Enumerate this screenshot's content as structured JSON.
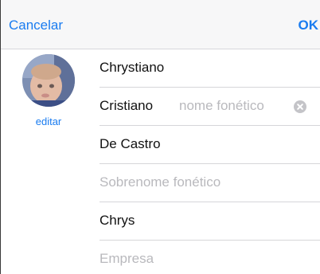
{
  "nav": {
    "cancel_label": "Cancelar",
    "ok_label": "OK"
  },
  "contact": {
    "edit_label": "editar",
    "first_name": "Chrystiano",
    "middle_name": "Cristiano",
    "middle_phonetic_placeholder": "nome fonético",
    "last_name": "De Castro",
    "last_phonetic_placeholder": "Sobrenome fonético",
    "nickname": "Chrys",
    "company_placeholder": "Empresa"
  },
  "icons": {
    "clear": "clear-icon",
    "avatar": "avatar-photo"
  },
  "colors": {
    "accent": "#1a7cf0",
    "placeholder": "#b9b9bd",
    "separator": "#d6d6d9"
  }
}
